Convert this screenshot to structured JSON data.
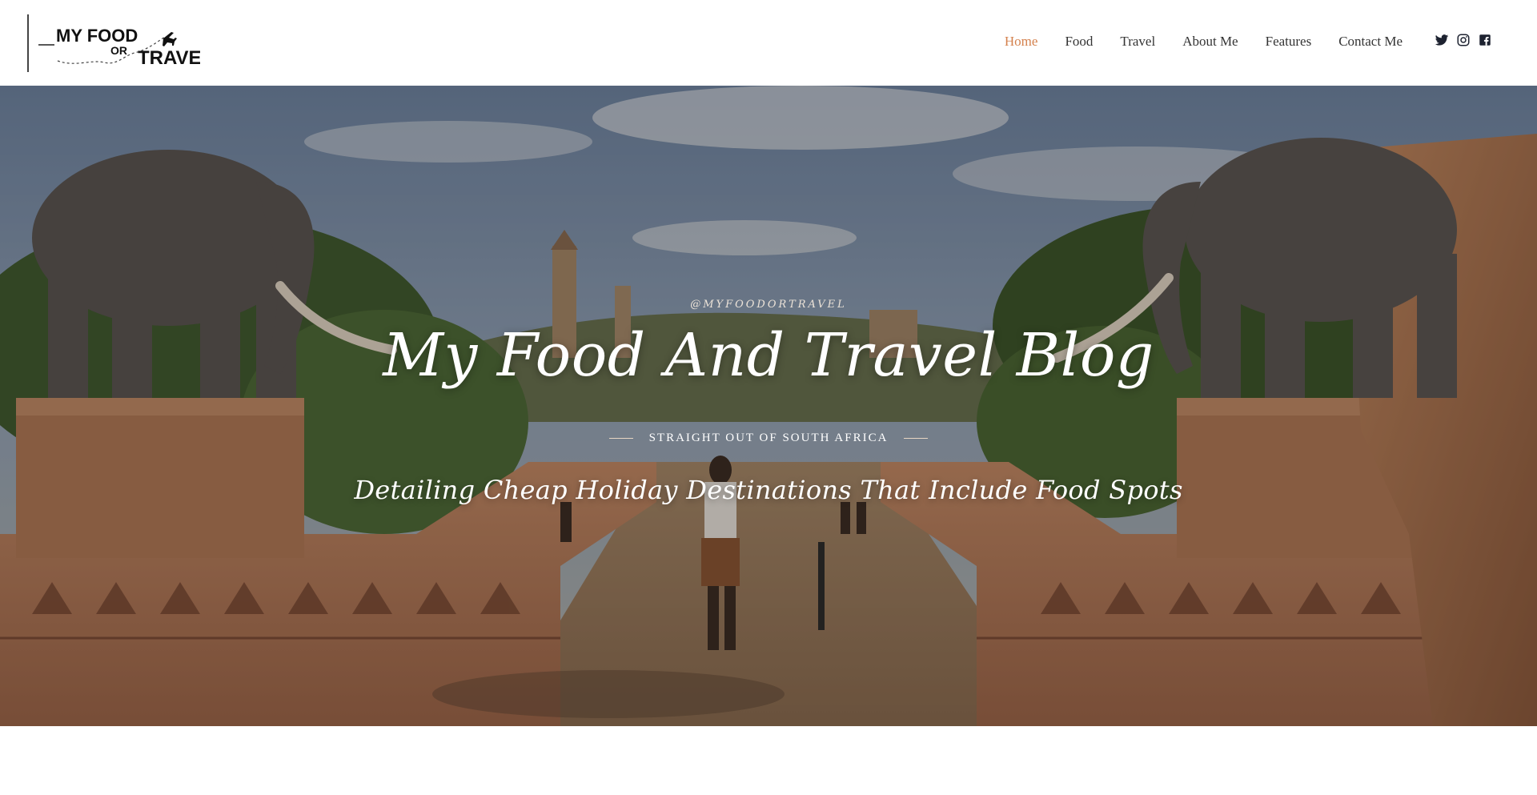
{
  "brand": {
    "logo_line1": "MY FOOD",
    "logo_or": "OR",
    "logo_line2": "TRAVEL"
  },
  "nav": {
    "items": [
      {
        "label": "Home",
        "active": true
      },
      {
        "label": "Food",
        "active": false
      },
      {
        "label": "Travel",
        "active": false
      },
      {
        "label": "About Me",
        "active": false
      },
      {
        "label": "Features",
        "active": false
      },
      {
        "label": "Contact Me",
        "active": false
      }
    ]
  },
  "social": {
    "icons": [
      "twitter-icon",
      "instagram-icon",
      "facebook-icon"
    ]
  },
  "hero": {
    "handle": "@MYFOODORTRAVEL",
    "title": "My Food And Travel Blog",
    "tagline": "STRAIGHT OUT OF SOUTH AFRICA",
    "subtitle": "Detailing Cheap Holiday Destinations That Include Food Spots"
  },
  "colors": {
    "accent": "#d4814d",
    "nav_text": "#333333",
    "hero_text": "#ffffff"
  }
}
